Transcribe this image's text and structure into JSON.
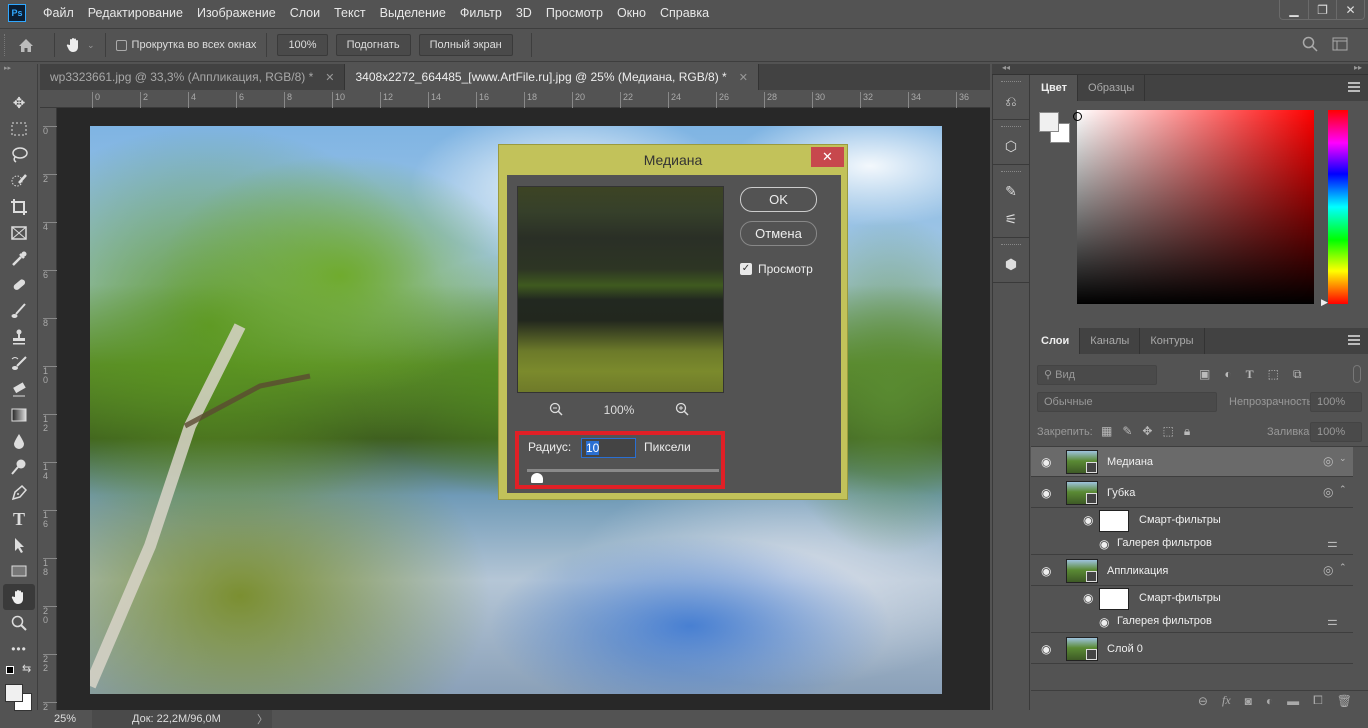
{
  "app": {
    "logo": "Ps"
  },
  "menu": [
    "Файл",
    "Редактирование",
    "Изображение",
    "Слои",
    "Текст",
    "Выделение",
    "Фильтр",
    "3D",
    "Просмотр",
    "Окно",
    "Справка"
  ],
  "window_controls": {
    "minimize": "▁",
    "restore": "❐",
    "close": "✕"
  },
  "options_bar": {
    "scroll_all_label": "Прокрутка во всех окнах",
    "scroll_all_checked": false,
    "zoom_100_label": "100%",
    "fit_label": "Подогнать",
    "fullscreen_label": "Полный экран"
  },
  "tabs": [
    {
      "label": "wp3323661.jpg @ 33,3% (Аппликация, RGB/8) *",
      "active": false,
      "close": "✕"
    },
    {
      "label": "3408x2272_664485_[www.ArtFile.ru].jpg @ 25% (Медиана, RGB/8) *",
      "active": true,
      "close": "✕"
    }
  ],
  "rulers": {
    "horizontal": [
      "0",
      "2",
      "4",
      "6",
      "8",
      "10",
      "12",
      "14",
      "16",
      "18",
      "20",
      "22",
      "24",
      "26",
      "28",
      "30",
      "32",
      "34",
      "36"
    ],
    "vertical": [
      "0",
      "2",
      "4",
      "6",
      "8",
      "10",
      "12",
      "14",
      "16",
      "18",
      "20",
      "22",
      "2"
    ]
  },
  "tools": [
    "move",
    "marquee",
    "lasso",
    "quick-selection",
    "crop",
    "frame",
    "eyedropper",
    "healing-brush",
    "brush",
    "clone-stamp",
    "history-brush",
    "eraser",
    "gradient",
    "blur",
    "dodge",
    "pen",
    "type",
    "path-selection",
    "rectangle",
    "hand",
    "zoom",
    "more"
  ],
  "active_tool": "hand",
  "dialog": {
    "title": "Медиана",
    "close": "✕",
    "ok_label": "OK",
    "cancel_label": "Отмена",
    "preview_label": "Просмотр",
    "preview_checked": true,
    "zoom_level": "100%",
    "radius_label": "Радиус:",
    "radius_value": "10",
    "units_label": "Пиксели",
    "slider_fraction": 0.02,
    "highlight_color": "#e01f26"
  },
  "color_panel": {
    "tabs": [
      "Цвет",
      "Образцы"
    ],
    "active_tab": "Цвет",
    "foreground": "#f0f0f0",
    "background": "#ffffff",
    "hue": "#ff0000"
  },
  "layers_panel": {
    "tabs": [
      "Слои",
      "Каналы",
      "Контуры"
    ],
    "active_tab": "Слои",
    "filter_placeholder": "Вид",
    "blend_mode": "Обычные",
    "opacity_label": "Непрозрачность:",
    "opacity_value": "100%",
    "lock_label": "Закрепить:",
    "fill_label": "Заливка:",
    "fill_value": "100%",
    "layers": [
      {
        "name": "Медиана",
        "selected": true
      },
      {
        "name": "Губка",
        "selected": false,
        "smart_filters": "Смарт-фильтры",
        "filter": "Галерея фильтров"
      },
      {
        "name": "Аппликация",
        "selected": false,
        "smart_filters": "Смарт-фильтры",
        "filter": "Галерея фильтров"
      },
      {
        "name": "Слой 0",
        "selected": false
      }
    ]
  },
  "status": {
    "zoom": "25%",
    "doc": "Док: 22,2M/96,0M",
    "arrow": "〉"
  }
}
